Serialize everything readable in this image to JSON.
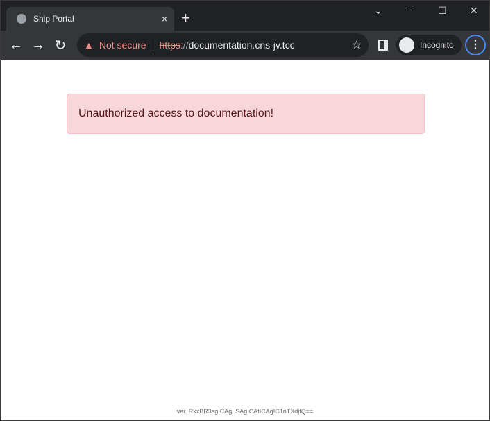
{
  "browser": {
    "tab_title": "Ship Portal",
    "tab_close": "×",
    "new_tab": "+",
    "security_label": "Not secure",
    "url_scheme": "https",
    "url_sep": "://",
    "url_host": "documentation.cns-jv.tcc",
    "profile_label": "Incognito"
  },
  "page": {
    "alert_message": "Unauthorized access to documentation!",
    "footer_version": "ver. RkxBR3sgICAgLSAgICAtICAgIC1nTXdjfQ=="
  }
}
